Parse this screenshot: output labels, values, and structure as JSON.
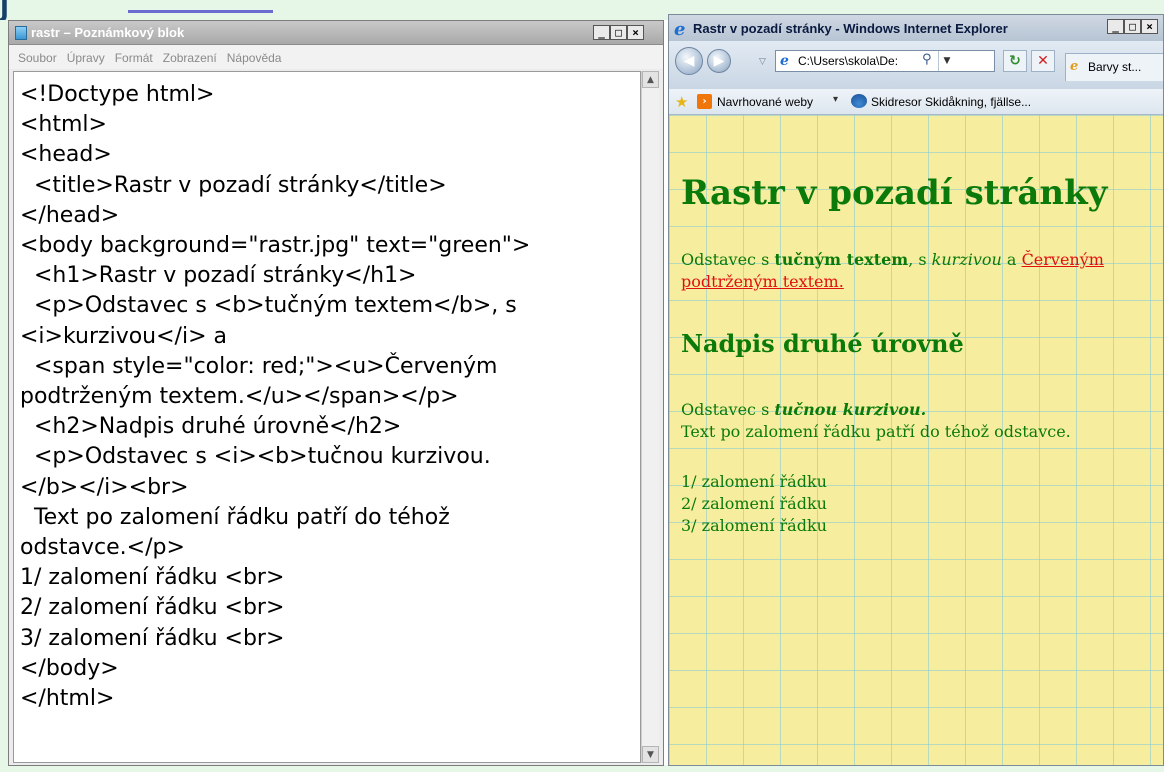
{
  "notepad": {
    "title": "rastr – Poznámkový blok",
    "menu": [
      "Soubor",
      "Úpravy",
      "Formát",
      "Zobrazení",
      "Nápověda"
    ],
    "content": "<!Doctype html>\n<html>\n<head>\n  <title>Rastr v pozadí stránky</title>\n</head>\n<body background=\"rastr.jpg\" text=\"green\">\n  <h1>Rastr v pozadí stránky</h1>\n  <p>Odstavec s <b>tučným textem</b>, s\n<i>kurzivou</i> a\n  <span style=\"color: red;\"><u>Červeným\npodtrženým textem.</u></span></p>\n  <h2>Nadpis druhé úrovně</h2>\n  <p>Odstavec s <i><b>tučnou kurzivou.\n</b></i><br>\n  Text po zalomení řádku patří do téhož\nodstavce.</p>\n1/ zalomení řádku <br>\n2/ zalomení řádku <br>\n3/ zalomení řádku <br>\n</body>\n</html>"
  },
  "window_buttons": {
    "minimize": "_",
    "maximize": "□",
    "close": "×"
  },
  "ie": {
    "title": "Rastr v pozadí stránky - Windows Internet Explorer",
    "address": "C:\\Users\\skola\\De:",
    "tab_label": "Barvy st...",
    "favorites": {
      "suggested": "Navrhované weby",
      "web_slice": "Skidresor Skidåkning, fjällse..."
    },
    "page": {
      "h1": "Rastr v pozadí stránky",
      "p1_prefix": "Odstavec s ",
      "p1_bold": "tučným textem",
      "p1_mid": ", s ",
      "p1_italic": "kurzivou",
      "p1_and": " a ",
      "p1_red": "Červeným podtrženým textem.",
      "h2": "Nadpis druhé úrovně",
      "p2_prefix": "Odstavec s ",
      "p2_bold_italic": "tučnou kurzivou.",
      "p2_line2": "Text po zalomení řádku patří do téhož odstavce.",
      "lines": [
        "1/ zalomení řádku",
        "2/ zalomení řádku",
        "3/ zalomení řádku"
      ]
    },
    "colors": {
      "page_background": "#f6ee9e",
      "text": "#0b7a0b",
      "red": "#e01010",
      "grid": "#82c8dc"
    }
  }
}
